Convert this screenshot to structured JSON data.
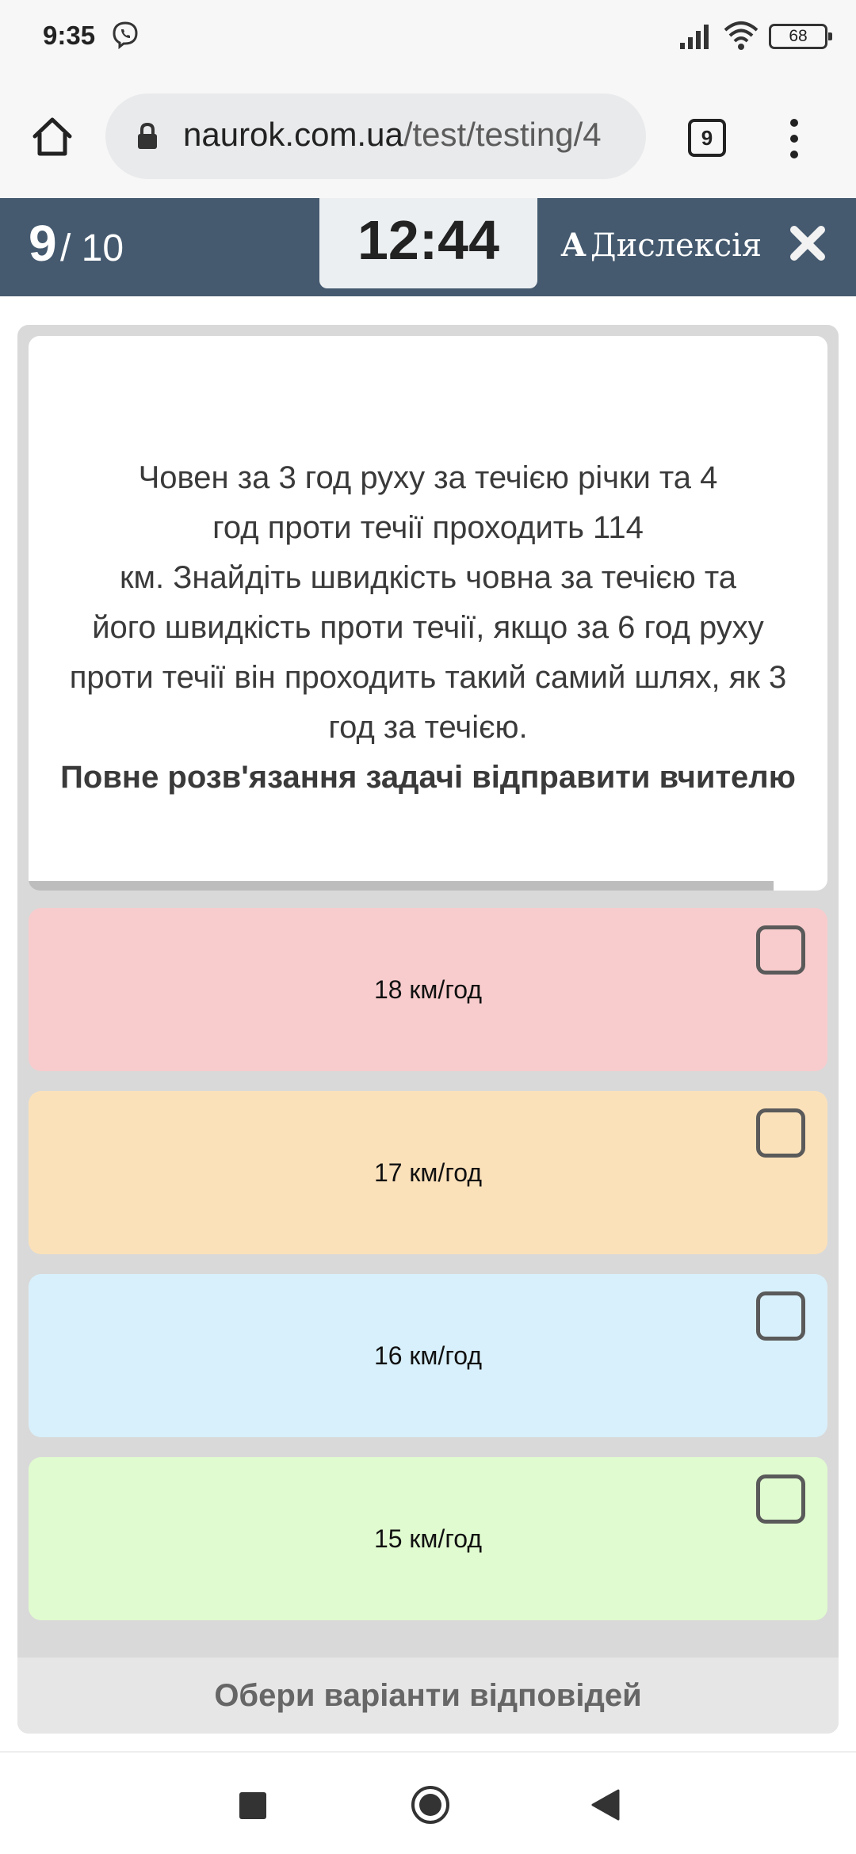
{
  "status_bar": {
    "time": "9:35",
    "battery": "68"
  },
  "browser": {
    "url_domain": "naurok.com.ua",
    "url_path": "/test/testing/4",
    "tab_count": "9"
  },
  "quiz_header": {
    "current": "9",
    "total": "/ 10",
    "timer": "12:44",
    "dyslexia_a": "A",
    "dyslexia_label": "Дислексія"
  },
  "question": {
    "lines": [
      "Човен за 3 год руху за течією річки та 4",
      "год проти течії проходить 114",
      "км. Знайдіть швидкість човна за течією та",
      "його швидкість проти течії, якщо за 6 год руху",
      "проти течії він проходить такий самий шлях, як 3",
      "год за течією."
    ],
    "bold_note": "Повне розв'язання задачі відправити вчителю"
  },
  "options": [
    {
      "label": "18 км/год",
      "color": "#f8cccd"
    },
    {
      "label": "17 км/год",
      "color": "#fbe1ba"
    },
    {
      "label": "16 км/год",
      "color": "#d8f0fb"
    },
    {
      "label": "15 км/год",
      "color": "#e0fbcf"
    }
  ],
  "submit_label": "Обери варіанти відповідей",
  "colors": {
    "header": "#455a6f",
    "panel": "#d9d9d9"
  }
}
